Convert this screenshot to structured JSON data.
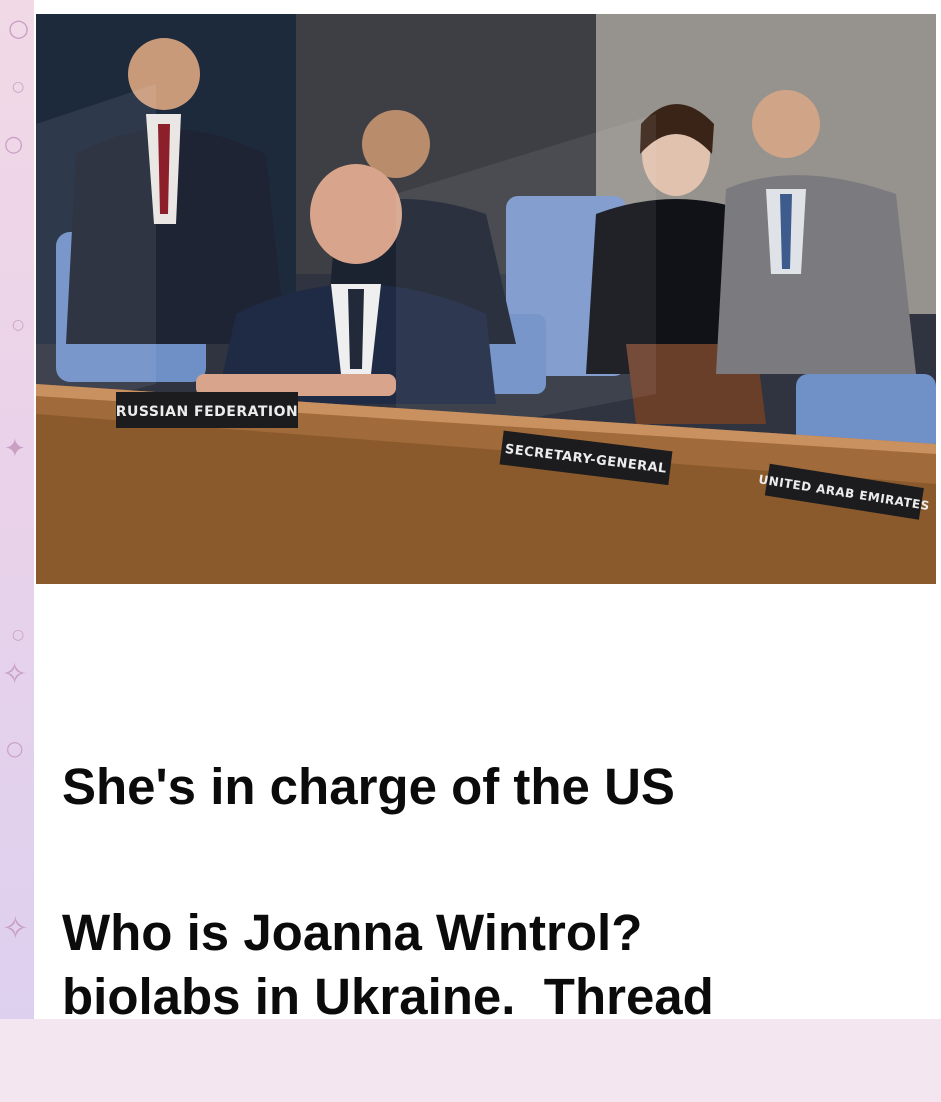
{
  "post": {
    "caption_line1": "She's in charge of the US",
    "caption_line2": "biolabs in Ukraine.  Thread",
    "question": "Who is Joanna Wintrol?"
  },
  "photo": {
    "nameplates": {
      "russia": "RUSSIAN FEDERATION",
      "secretary": "SECRETARY-GENERAL",
      "uae": "UNITED ARAB EMIRATES"
    }
  },
  "colors": {
    "background_strip": "#f1d9e6",
    "card": "#ffffff",
    "text": "#0b0b0b",
    "decoration": "#c99fc4"
  }
}
